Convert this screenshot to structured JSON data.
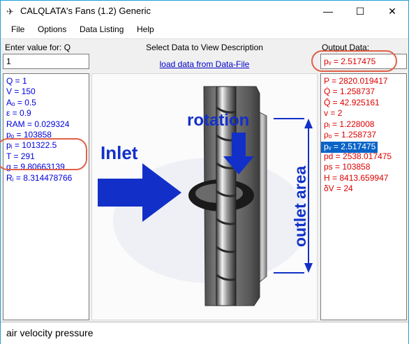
{
  "window": {
    "title": "CALQLATA's  Fans (1.2)  Generic",
    "minimize_glyph": "—",
    "maximize_glyph": "☐",
    "close_glyph": "✕"
  },
  "menu": [
    "File",
    "Options",
    "Data Listing",
    "Help"
  ],
  "input": {
    "label": "Enter value for: Q",
    "value": "1"
  },
  "center": {
    "header": "Select Data to View Description",
    "load_link": "load data from Data-File"
  },
  "output": {
    "label": "Output Data:",
    "value": "pᵥ = 2.517475"
  },
  "inputs_list": [
    "Q = 1",
    "V = 150",
    "Aₒ = 0.5",
    "ε = 0.9",
    "RAM = 0.029324",
    "pₒ = 103858",
    "pᵢ = 101322.5",
    "T = 291",
    "g = 9.80663139",
    "Rᵢ = 8.314478766"
  ],
  "outputs_list": [
    "P = 2820.019417",
    "Q̇ = 1.258737",
    "Q̄ = 42.925161",
    "v = 2",
    "ρᵢ = 1.228008",
    "ρₒ = 1.258737",
    "pᵥ = 2.517475",
    "pd = 2538.017475",
    "ps = 103858",
    "H = 8413.659947",
    "δV = 24"
  ],
  "selected_output_index": 6,
  "diagram": {
    "inlet_label": "Inlet",
    "rotation_label": "rotation",
    "outlet_label": "outlet area"
  },
  "status": "air velocity pressure",
  "colors": {
    "input_text": "#0000dd",
    "output_text": "#dd0000",
    "selection": "#0a64c8",
    "callout": "#e06048",
    "arrow": "#1230c8"
  }
}
